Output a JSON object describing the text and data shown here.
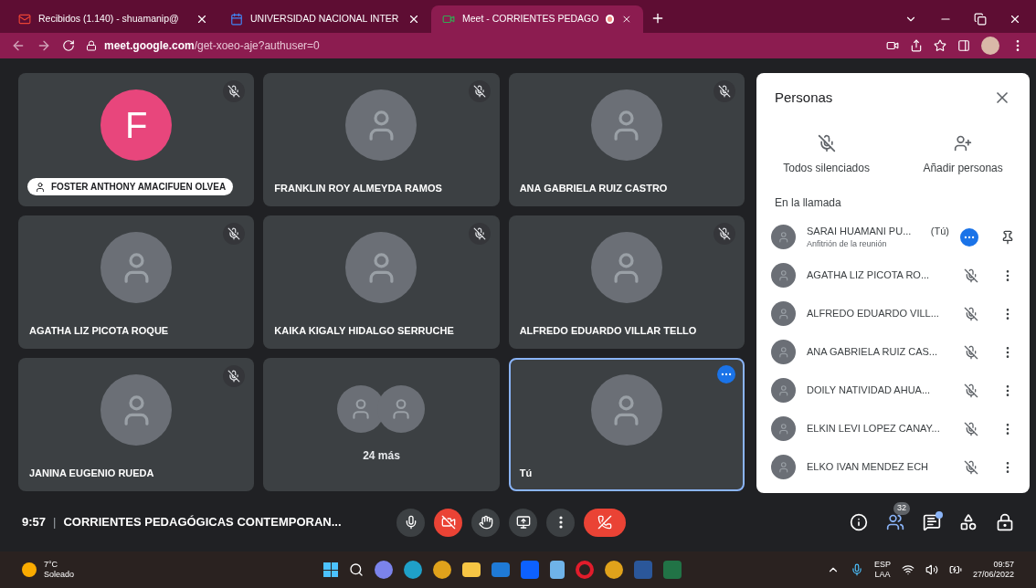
{
  "browser": {
    "tabs": [
      {
        "title": "Recibidos (1.140) - shuamanip@",
        "selected": false
      },
      {
        "title": "UNIVERSIDAD NACIONAL INTER",
        "selected": false
      },
      {
        "title": "Meet - CORRIENTES PEDAGO",
        "selected": true,
        "recording": true
      }
    ],
    "url_host": "meet.google.com",
    "url_path": "/get-xoeo-aje?authuser=0"
  },
  "tiles": [
    {
      "kind": "letter",
      "name": "FOSTER ANTHONY AMACIFUEN OLVEA",
      "letter": "F",
      "color": "#e8467c",
      "muted": true,
      "pinned_label": true,
      "selected": false
    },
    {
      "kind": "photo",
      "name": "FRANKLIN ROY ALMEYDA RAMOS",
      "muted": true,
      "pinned_label": false,
      "selected": false
    },
    {
      "kind": "photo",
      "name": "ANA GABRIELA RUIZ CASTRO",
      "muted": true,
      "pinned_label": false,
      "selected": false
    },
    {
      "kind": "photo",
      "name": "AGATHA LIZ PICOTA ROQUE",
      "muted": true,
      "pinned_label": false,
      "selected": false
    },
    {
      "kind": "photo",
      "name": "KAIKA KIGALY HIDALGO SERRUCHE",
      "muted": true,
      "pinned_label": false,
      "selected": false
    },
    {
      "kind": "photo",
      "name": "ALFREDO EDUARDO VILLAR TELLO",
      "muted": true,
      "pinned_label": false,
      "selected": false
    },
    {
      "kind": "photo",
      "name": "JANINA EUGENIO RUEDA",
      "muted": true,
      "pinned_label": false,
      "selected": false
    },
    {
      "kind": "group",
      "name": "24 más",
      "selected": false
    },
    {
      "kind": "photo",
      "name": "Tú",
      "selected": true
    }
  ],
  "panel": {
    "title": "Personas",
    "actions": [
      {
        "kind": "mute-all",
        "label": "Todos silenciados"
      },
      {
        "kind": "add",
        "label": "Añadir personas"
      }
    ],
    "section": "En la llamada",
    "people": [
      {
        "name": "SARAI HUAMANI PU...",
        "suffix": "(Tú)",
        "subtitle": "Anfitrión de la reunión",
        "host": true
      },
      {
        "name": "AGATHA LIZ PICOTA RO...",
        "host": false,
        "muted": true
      },
      {
        "name": "ALFREDO EDUARDO VILL...",
        "host": false,
        "muted": true
      },
      {
        "name": "ANA GABRIELA RUIZ CAS...",
        "host": false,
        "muted": true
      },
      {
        "name": "DOILY NATIVIDAD AHUA...",
        "host": false,
        "muted": true
      },
      {
        "name": "ELKIN LEVI LOPEZ CANAY...",
        "host": false,
        "muted": true
      },
      {
        "name": "ELKO IVAN MENDEZ ECH",
        "host": false,
        "muted": true
      }
    ]
  },
  "bar": {
    "time": "9:57",
    "separator": "|",
    "meeting": "CORRIENTES PEDAGÓGICAS CONTEMPORAN...",
    "controls": [
      {
        "kind": "mic",
        "off": false
      },
      {
        "kind": "camera",
        "off": true
      },
      {
        "kind": "hand",
        "off": false
      },
      {
        "kind": "present",
        "off": false
      },
      {
        "kind": "more",
        "off": false
      },
      {
        "kind": "leave"
      }
    ],
    "people_count": "32",
    "chat_unread": true
  },
  "taskbar": {
    "temperature": "7°C",
    "weather": "Soleado",
    "lang": "ESP",
    "layout": "LAA",
    "time": "09:57",
    "date": "27/06/2022"
  }
}
